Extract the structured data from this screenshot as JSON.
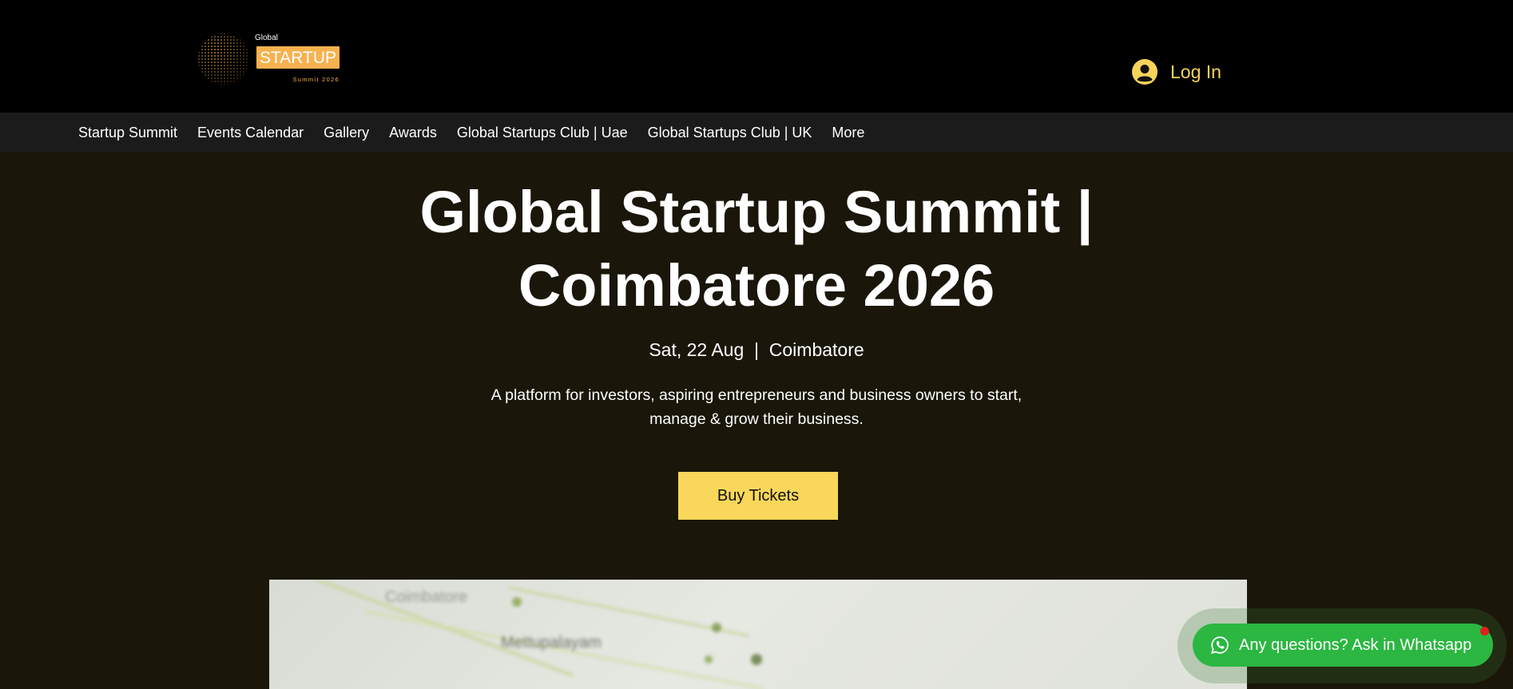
{
  "header": {
    "logo": {
      "small_text": "Global",
      "main_text": "STARTUP",
      "sub_text": "Summit 2026",
      "accent_color": "#f7b24f"
    },
    "login": {
      "label": "Log In",
      "icon": "user-avatar-icon",
      "color": "#f8d35a"
    }
  },
  "nav": {
    "items": [
      {
        "label": "Startup Summit"
      },
      {
        "label": "Events Calendar"
      },
      {
        "label": "Gallery"
      },
      {
        "label": "Awards"
      },
      {
        "label": "Global Startups Club | Uae"
      },
      {
        "label": "Global Startups Club | UK"
      },
      {
        "label": "More"
      }
    ]
  },
  "hero": {
    "title_line1": "Global Startup Summit |",
    "title_line2": "Coimbatore 2026",
    "date_location": "Sat, 22 Aug  |  Coimbatore",
    "description_line1": "A platform for investors, aspiring entrepreneurs and business owners to start,",
    "description_line2": "manage & grow their business.",
    "cta_label": "Buy Tickets",
    "cta_color": "#f9d75a",
    "image_text_1": "Coimbatore",
    "image_text_2": "Mettupalayam"
  },
  "chat": {
    "label": "Any questions? Ask in Whatsapp",
    "icon": "whatsapp-icon",
    "color": "#2bb741"
  }
}
